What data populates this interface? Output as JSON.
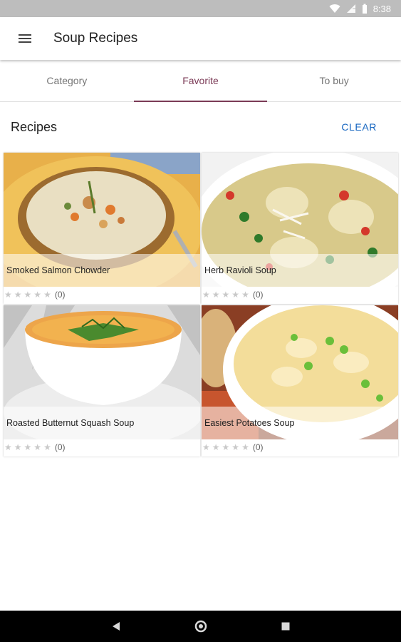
{
  "status_bar": {
    "time": "8:38"
  },
  "app_bar": {
    "title": "Soup Recipes",
    "menu_icon": "hamburger-menu-icon"
  },
  "tabs": [
    {
      "label": "Category",
      "active": false
    },
    {
      "label": "Favorite",
      "active": true
    },
    {
      "label": "To buy",
      "active": false
    }
  ],
  "section": {
    "title": "Recipes",
    "clear_label": "CLEAR"
  },
  "recipes": [
    {
      "name": "Smoked Salmon Chowder",
      "rating_count": "(0)",
      "stars": 0
    },
    {
      "name": "Herb Ravioli Soup",
      "rating_count": "(0)",
      "stars": 0
    },
    {
      "name": "Roasted Butternut Squash Soup",
      "rating_count": "(0)",
      "stars": 0
    },
    {
      "name": "Easiest Potatoes Soup",
      "rating_count": "(0)",
      "stars": 0
    }
  ],
  "colors": {
    "accent": "#7b3a56",
    "link": "#1565c0",
    "status_bar": "#bdbdbd"
  }
}
